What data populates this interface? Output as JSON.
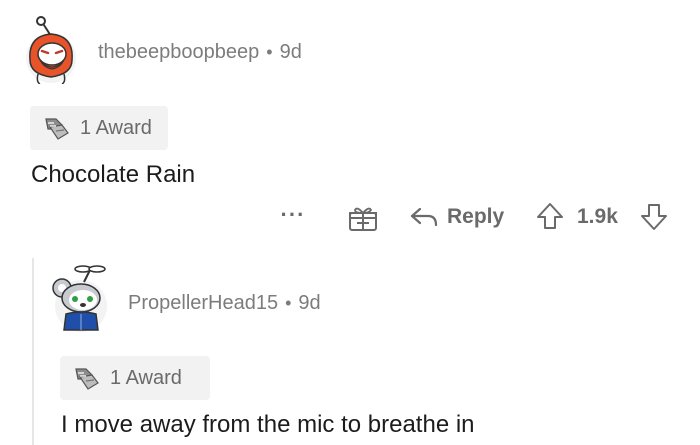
{
  "top_comment": {
    "username": "thebeepboopbeep",
    "separator": "•",
    "time": "9d",
    "award_label": "1 Award",
    "body": "Chocolate Rain"
  },
  "actions": {
    "more_label": "···",
    "reply_label": "Reply",
    "score": "1.9k"
  },
  "reply_comment": {
    "username": "PropellerHead15",
    "separator": "•",
    "time": "9d",
    "award_label": "1 Award",
    "body": "I move away from the mic to breathe in"
  },
  "icons": {
    "award": "award-icon",
    "gift": "gift-icon",
    "reply": "reply-arrow-icon",
    "upvote": "upvote-arrow-icon",
    "downvote": "downvote-arrow-icon"
  },
  "colors": {
    "meta_text": "#7c7c7c",
    "action_text": "#6a6a6a",
    "badge_bg": "#f2f2f2",
    "body_text": "#1c1c1c",
    "avatar_orange": "#e8532a"
  }
}
